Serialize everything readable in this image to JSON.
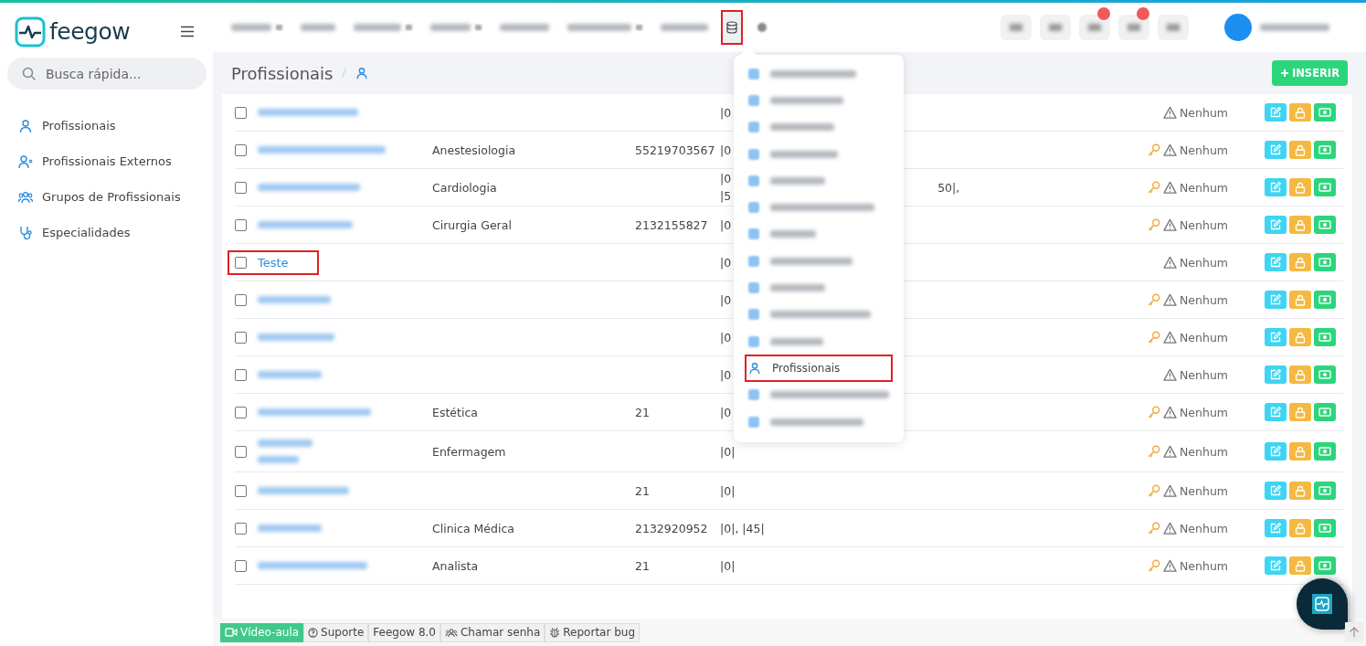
{
  "app": {
    "logo": "feegow"
  },
  "sidebar": {
    "search": {
      "placeholder": "Busca rápida..."
    },
    "items": [
      {
        "label": "Profissionais"
      },
      {
        "label": "Profissionais Externos"
      },
      {
        "label": "Grupos de Profissionais"
      },
      {
        "label": "Especialidades"
      }
    ]
  },
  "topnav": {
    "items": [
      {
        "caret": true
      },
      {
        "caret": false
      },
      {
        "caret": true
      },
      {
        "caret": true
      },
      {
        "caret": false
      },
      {
        "caret": true
      },
      {
        "caret": false
      }
    ],
    "database_button": {
      "highlighted": true
    },
    "toolbar": [
      {
        "badge": false
      },
      {
        "badge": false
      },
      {
        "badge": true
      },
      {
        "badge": true
      },
      {
        "badge": false
      }
    ]
  },
  "page": {
    "title": "Profissionais",
    "insert_button": "INSERIR"
  },
  "dropdown": {
    "items": [
      {
        "selected": false
      },
      {
        "selected": false
      },
      {
        "selected": false
      },
      {
        "selected": false
      },
      {
        "selected": false
      },
      {
        "selected": false
      },
      {
        "selected": false
      },
      {
        "selected": false
      },
      {
        "selected": false
      },
      {
        "selected": false
      },
      {
        "selected": false
      },
      {
        "label": "Profissionais",
        "selected": true
      },
      {
        "selected": false
      },
      {
        "selected": false
      }
    ]
  },
  "table": {
    "rows": [
      {
        "highlighted": false,
        "name_wrapped": false,
        "units": [
          "|0"
        ],
        "key": false,
        "status": "Nenhum"
      },
      {
        "highlighted": false,
        "name_wrapped": false,
        "specialty": "Anestesiologia",
        "phone": "55219703567",
        "units": [
          "|0"
        ],
        "key": true,
        "status": "Nenhum"
      },
      {
        "highlighted": false,
        "name_wrapped": false,
        "specialty": "Cardiologia",
        "units": [
          "|0",
          "|5"
        ],
        "units_tail": "50|,",
        "key": true,
        "status": "Nenhum"
      },
      {
        "highlighted": false,
        "name_wrapped": false,
        "specialty": "Cirurgia Geral",
        "phone": "2132155827",
        "units": [
          "|0"
        ],
        "key": true,
        "status": "Nenhum"
      },
      {
        "name": "Teste",
        "highlighted": true,
        "units": [
          "|0"
        ],
        "key": false,
        "status": "Nenhum"
      },
      {
        "highlighted": false,
        "name_wrapped": false,
        "units": [
          "|0"
        ],
        "key": true,
        "status": "Nenhum"
      },
      {
        "highlighted": false,
        "name_wrapped": false,
        "units": [
          "|0"
        ],
        "key": true,
        "status": "Nenhum"
      },
      {
        "highlighted": false,
        "name_wrapped": false,
        "units": [
          "|0"
        ],
        "key": false,
        "status": "Nenhum"
      },
      {
        "highlighted": false,
        "name_wrapped": false,
        "specialty": "Estética",
        "phone": "21",
        "units": [
          "|0"
        ],
        "key": true,
        "status": "Nenhum"
      },
      {
        "highlighted": false,
        "name_wrapped": true,
        "specialty": "Enfermagem",
        "units": [
          "|0|"
        ],
        "key": true,
        "status": "Nenhum"
      },
      {
        "highlighted": false,
        "name_wrapped": false,
        "phone": "21",
        "units": [
          "|0|"
        ],
        "key": true,
        "status": "Nenhum"
      },
      {
        "highlighted": false,
        "name_wrapped": false,
        "specialty": "Clinica Médica",
        "phone": "2132920952",
        "units": [
          "|0|, |45|"
        ],
        "key": true,
        "status": "Nenhum"
      },
      {
        "highlighted": false,
        "name_wrapped": false,
        "specialty": "Analista",
        "phone": "21",
        "units": [
          "|0|"
        ],
        "key": true,
        "status": "Nenhum"
      }
    ]
  },
  "footer": {
    "buttons": [
      {
        "label": "Vídeo-aula",
        "kind": "video"
      },
      {
        "label": "Suporte",
        "kind": "help"
      },
      {
        "label": "Feegow 8.0",
        "kind": "plain"
      },
      {
        "label": "Chamar senha",
        "kind": "people"
      },
      {
        "label": "Reportar bug",
        "kind": "bug"
      }
    ]
  }
}
